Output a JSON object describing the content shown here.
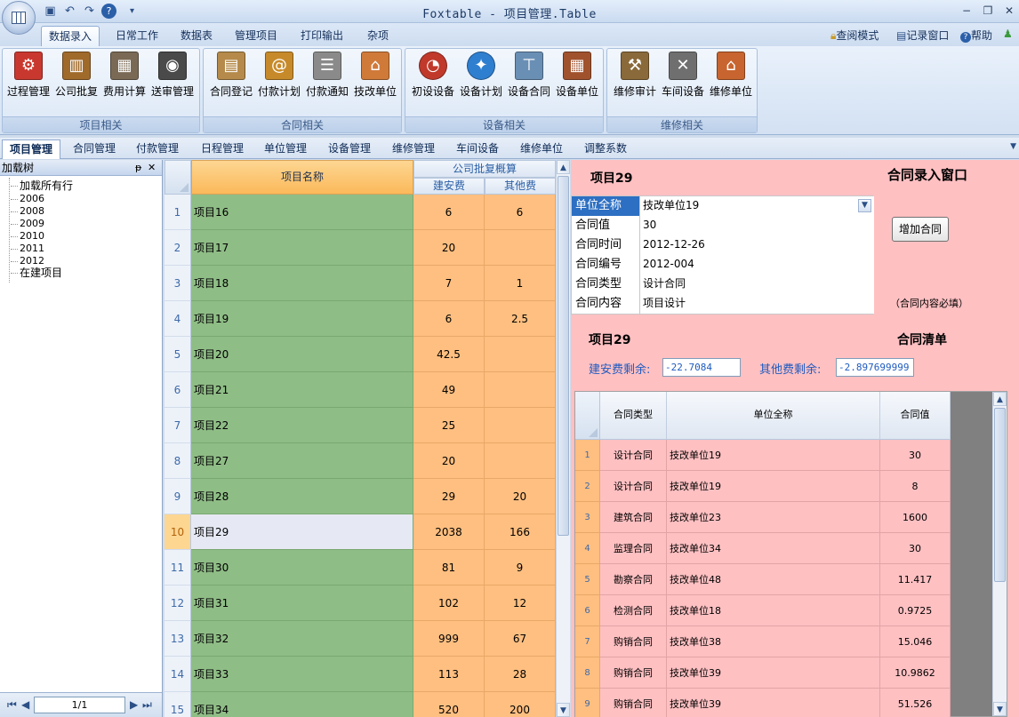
{
  "window": {
    "title": "Foxtable - 项目管理.Table",
    "controls": {
      "minimize": "−",
      "restore": "❐",
      "close": "✕"
    }
  },
  "ribbon": {
    "tabs": [
      "数据录入",
      "日常工作",
      "数据表",
      "管理项目",
      "打印输出",
      "杂项"
    ],
    "active_tab": "数据录入",
    "tools": {
      "read_mode": "查阅模式",
      "log_window": "记录窗口",
      "help": "帮助"
    },
    "groups": [
      {
        "label": "项目相关",
        "buttons": [
          "过程管理",
          "公司批复",
          "费用计算",
          "送审管理"
        ]
      },
      {
        "label": "合同相关",
        "buttons": [
          "合同登记",
          "付款计划",
          "付款通知",
          "技改单位"
        ]
      },
      {
        "label": "设备相关",
        "buttons": [
          "初设设备",
          "设备计划",
          "设备合同",
          "设备单位"
        ]
      },
      {
        "label": "维修相关",
        "buttons": [
          "维修审计",
          "车间设备",
          "维修单位"
        ]
      }
    ]
  },
  "module_tabs": [
    "项目管理",
    "合同管理",
    "付款管理",
    "日程管理",
    "单位管理",
    "设备管理",
    "维修管理",
    "车间设备",
    "维修单位",
    "调整系数"
  ],
  "active_module": "项目管理",
  "left_panel": {
    "title": "加载树",
    "pin": "ᵽ",
    "close": "✕",
    "tree": [
      "加载所有行",
      "2006",
      "2008",
      "2009",
      "2010",
      "2011",
      "2012",
      "在建项目"
    ],
    "pager": "1/1"
  },
  "grid": {
    "headers": {
      "name": "项目名称",
      "group": "公司批复概算",
      "col1": "建安费",
      "col2": "其他费"
    },
    "rows": [
      {
        "n": "1",
        "name": "项目16",
        "v1": "6",
        "v2": "6"
      },
      {
        "n": "2",
        "name": "项目17",
        "v1": "20",
        "v2": ""
      },
      {
        "n": "3",
        "name": "项目18",
        "v1": "7",
        "v2": "1"
      },
      {
        "n": "4",
        "name": "项目19",
        "v1": "6",
        "v2": "2.5"
      },
      {
        "n": "5",
        "name": "项目20",
        "v1": "42.5",
        "v2": ""
      },
      {
        "n": "6",
        "name": "项目21",
        "v1": "49",
        "v2": ""
      },
      {
        "n": "7",
        "name": "项目22",
        "v1": "25",
        "v2": ""
      },
      {
        "n": "8",
        "name": "项目27",
        "v1": "20",
        "v2": ""
      },
      {
        "n": "9",
        "name": "项目28",
        "v1": "29",
        "v2": "20"
      },
      {
        "n": "10",
        "name": "项目29",
        "v1": "2038",
        "v2": "166"
      },
      {
        "n": "11",
        "name": "项目30",
        "v1": "81",
        "v2": "9"
      },
      {
        "n": "12",
        "name": "项目31",
        "v1": "102",
        "v2": "12"
      },
      {
        "n": "13",
        "name": "项目32",
        "v1": "999",
        "v2": "67"
      },
      {
        "n": "14",
        "name": "项目33",
        "v1": "113",
        "v2": "28"
      },
      {
        "n": "15",
        "name": "项目34",
        "v1": "520",
        "v2": "200"
      }
    ],
    "selected_row": "10"
  },
  "right_panel": {
    "project_title": "项目29",
    "window_title": "合同录入窗口",
    "form": [
      {
        "label": "单位全称",
        "value": "技改单位19"
      },
      {
        "label": "合同值",
        "value": "30"
      },
      {
        "label": "合同时间",
        "value": "2012-12-26"
      },
      {
        "label": "合同编号",
        "value": "2012-004"
      },
      {
        "label": "合同类型",
        "value": "设计合同"
      },
      {
        "label": "合同内容",
        "value": "项目设计"
      }
    ],
    "add_button": "增加合同",
    "note": "（合同内容必填）",
    "list_project_title": "项目29",
    "list_title": "合同清单",
    "remaining_build_label": "建安费剩余:",
    "remaining_build_value": "-22.7084",
    "remaining_other_label": "其他费剩余:",
    "remaining_other_value": "-2.897699999",
    "contract_headers": [
      "合同类型",
      "单位全称",
      "合同值"
    ],
    "contracts": [
      {
        "n": "1",
        "type": "设计合同",
        "unit": "技改单位19",
        "value": "30"
      },
      {
        "n": "2",
        "type": "设计合同",
        "unit": "技改单位19",
        "value": "8"
      },
      {
        "n": "3",
        "type": "建筑合同",
        "unit": "技改单位23",
        "value": "1600"
      },
      {
        "n": "4",
        "type": "监理合同",
        "unit": "技改单位34",
        "value": "30"
      },
      {
        "n": "5",
        "type": "勘察合同",
        "unit": "技改单位48",
        "value": "11.417"
      },
      {
        "n": "6",
        "type": "检测合同",
        "unit": "技改单位18",
        "value": "0.9725"
      },
      {
        "n": "7",
        "type": "购销合同",
        "unit": "技改单位38",
        "value": "15.046"
      },
      {
        "n": "8",
        "type": "购销合同",
        "unit": "技改单位39",
        "value": "10.9862"
      },
      {
        "n": "9",
        "type": "购销合同",
        "unit": "技改单位39",
        "value": "51.526"
      }
    ]
  },
  "icons": {
    "ribbon": [
      "process-icon",
      "approval-icon",
      "calculator-icon",
      "review-icon",
      "book-icon",
      "address-book-icon",
      "document-icon",
      "house-icon",
      "alarm-bell-icon",
      "compass-icon",
      "faucet-icon",
      "building-icon",
      "hammer-icon",
      "tools-icon",
      "house-icon"
    ],
    "colors": [
      "#c9382f",
      "#a06a2b",
      "#7a6a55",
      "#4a4a4a",
      "#b58a4a",
      "#c78a2a",
      "#8a8a8a",
      "#d07a3a",
      "#c0392b",
      "#2f7fd0",
      "#6a8fb5",
      "#a0522d",
      "#8a6a3a",
      "#6f6f6f",
      "#c8642f"
    ]
  }
}
